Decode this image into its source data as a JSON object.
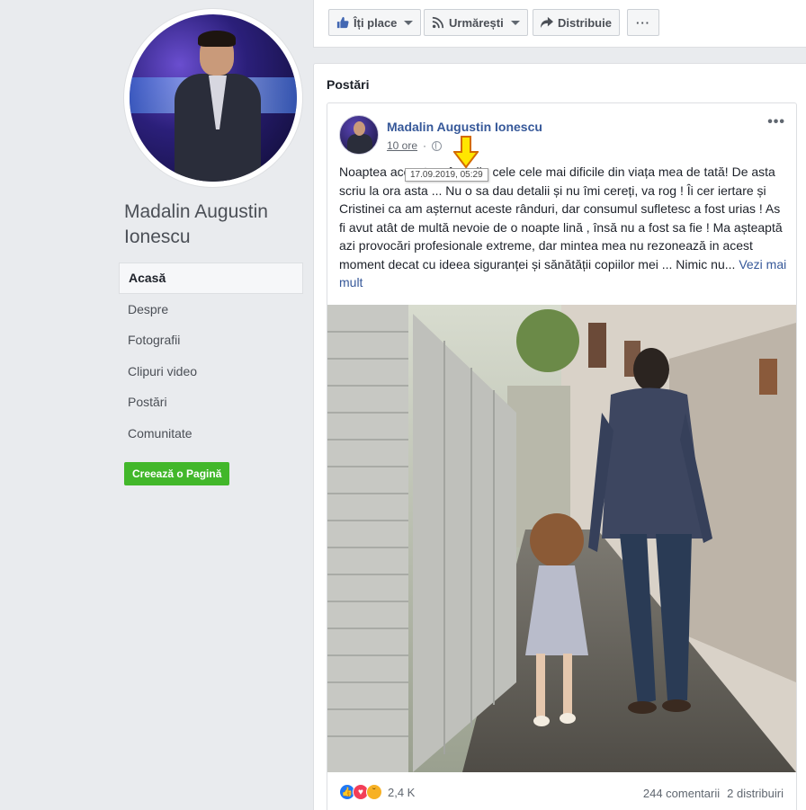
{
  "page": {
    "name": "Madalin Augustin Ionescu",
    "create_page_label": "Creează o Pagină"
  },
  "sidebar": {
    "items": [
      {
        "label": "Acasă",
        "active": true
      },
      {
        "label": "Despre"
      },
      {
        "label": "Fotografii"
      },
      {
        "label": "Clipuri video"
      },
      {
        "label": "Postări"
      },
      {
        "label": "Comunitate"
      }
    ]
  },
  "action_bar": {
    "like_label": "Îți place",
    "follow_label": "Urmărești",
    "share_label": "Distribuie",
    "more_label": "···"
  },
  "posts": {
    "section_title": "Postări",
    "post": {
      "author": "Madalin Augustin Ionescu",
      "time": "10 ore",
      "tooltip": "17.09.2019, 05:29",
      "text": "Noaptea aceasta a fost din cele cele mai dificile din viața mea de tată! De asta scriu la ora asta ... Nu o sa dau detalii și nu îmi cereți, va rog ! Îi cer iertare și Cristinei ca am așternut aceste rânduri, dar consumul sufletesc a fost urias ! As fi avut atât de multă nevoie de o noapte lină , însă nu a fost sa fie ! Ma așteaptă azi provocări profesionale extreme, dar mintea mea nu rezonează in acest moment decat cu ideea siguranței și sănătății copiilor mei ... Nimic nu...",
      "see_more": "Vezi mai mult",
      "reaction_count": "2,4 K",
      "comments": "244 comentarii",
      "shares": "2 distribuiri"
    }
  }
}
